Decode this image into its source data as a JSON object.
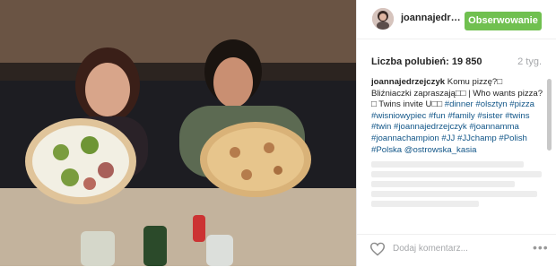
{
  "post": {
    "photo_alt": "Two women with large pizzas",
    "username": "joannajedrzejczyk",
    "username_short": "joannajedrz...",
    "follow_label": "Obserwowanie",
    "likes_label": "Liczba polubień: 19 850",
    "age_label": "2 tyg.",
    "caption_user": "joannajedrzejczyk",
    "caption_text": " Komu pizzę?□ Bliźniaczki zapraszają□□ | Who wants pizza?□ Twins invite U□□ ",
    "hashtags": "#dinner #olsztyn #pizza #wisniowypiec #fun #family #sister #twins #twin #joannajedrzejczyk #joannamma #joannachampion #JJ #JJchamp #Polish #Polska @ostrowska_kasia",
    "add_comment_placeholder": "Dodaj komentarz...",
    "more_label": "•••"
  },
  "colors": {
    "follow_bg": "#70c050",
    "link": "#125688",
    "muted": "#a5a7aa"
  }
}
